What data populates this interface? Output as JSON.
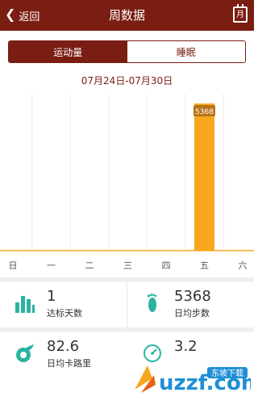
{
  "header": {
    "back_label": "返回",
    "title": "周数据",
    "calendar_label": "月"
  },
  "tabs": [
    {
      "label": "运动量",
      "active": true
    },
    {
      "label": "睡眠",
      "active": false
    }
  ],
  "date_range": "07月24日-07月30日",
  "chart_data": {
    "type": "bar",
    "categories": [
      "日",
      "一",
      "二",
      "三",
      "四",
      "五",
      "六"
    ],
    "values": [
      0,
      0,
      0,
      0,
      0,
      5368,
      0
    ],
    "value_label": "5368",
    "color": "#f7a71b"
  },
  "stats": [
    {
      "value": "1",
      "label": "达标天数",
      "icon": "bar-chart-icon"
    },
    {
      "value": "5368",
      "label": "日均步数",
      "icon": "footprint-icon"
    },
    {
      "value": "82.6",
      "label": "日均卡路里",
      "icon": "flame-icon"
    },
    {
      "value": "3.2",
      "label": "",
      "icon": "gauge-icon"
    }
  ],
  "watermark": "uzzf.com",
  "watermark_sub": "东坡下载",
  "colors": {
    "brand": "#7a1d12",
    "accent": "#f7a71b",
    "teal": "#2bb3a0"
  }
}
